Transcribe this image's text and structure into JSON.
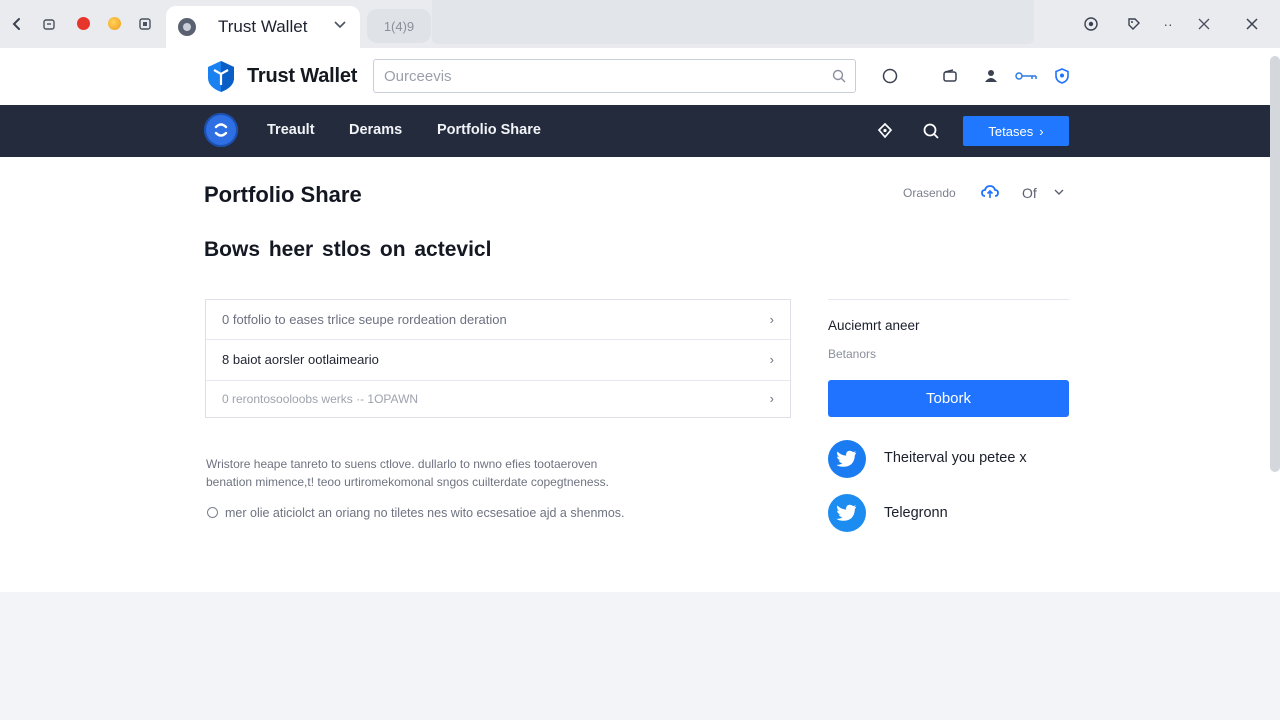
{
  "browser": {
    "active_tab_title": "Trust Wallet",
    "inactive_tab_label": "1(4)9"
  },
  "header": {
    "brand": "Trust Wallet",
    "search_placeholder": "Ourceevis"
  },
  "nav": {
    "items": [
      {
        "label": "Treault"
      },
      {
        "label": "Derams"
      },
      {
        "label": "Portfolio Share"
      }
    ],
    "cta_label": "Tetases",
    "cta_arrow": "›"
  },
  "main": {
    "title": "Portfolio Share",
    "status_text": "Orasendo",
    "language": "Of",
    "subtitle": "Bows heer stlos on actevicl",
    "list": [
      {
        "text": "0 fotfolio to eases trlice seupe rordeation deration",
        "style": "muted"
      },
      {
        "text": "8 baiot aorsler ootlaimeario",
        "style": "dark"
      },
      {
        "text": "0 rerontosooloobs werks   ·- 1OPAWN",
        "style": "faint"
      }
    ],
    "paragraph_line1": "Wristore heape tanreto to suens ctlove. dullarlo to nwno efies tootaeroven",
    "paragraph_line2": "benation mimence,t! teoo urtiromekomonal sngos cuilterdate copegtneness.",
    "radio_text": "mer olie aticiolct an oriang no tiletes nes wito ecsesatioe ajd a shenmos."
  },
  "panel": {
    "heading": "Auciemrt aneer",
    "subtext": "Betanors",
    "button_label": "Tobork",
    "socials": [
      {
        "label": "Theiterval you petee x",
        "icon": "twitter-icon"
      },
      {
        "label": "Telegronn",
        "icon": "twitter-icon"
      }
    ]
  },
  "colors": {
    "accent": "#1f73ff",
    "nav_bg": "#232b3d",
    "twitter_blue": "#1d8cf0"
  }
}
